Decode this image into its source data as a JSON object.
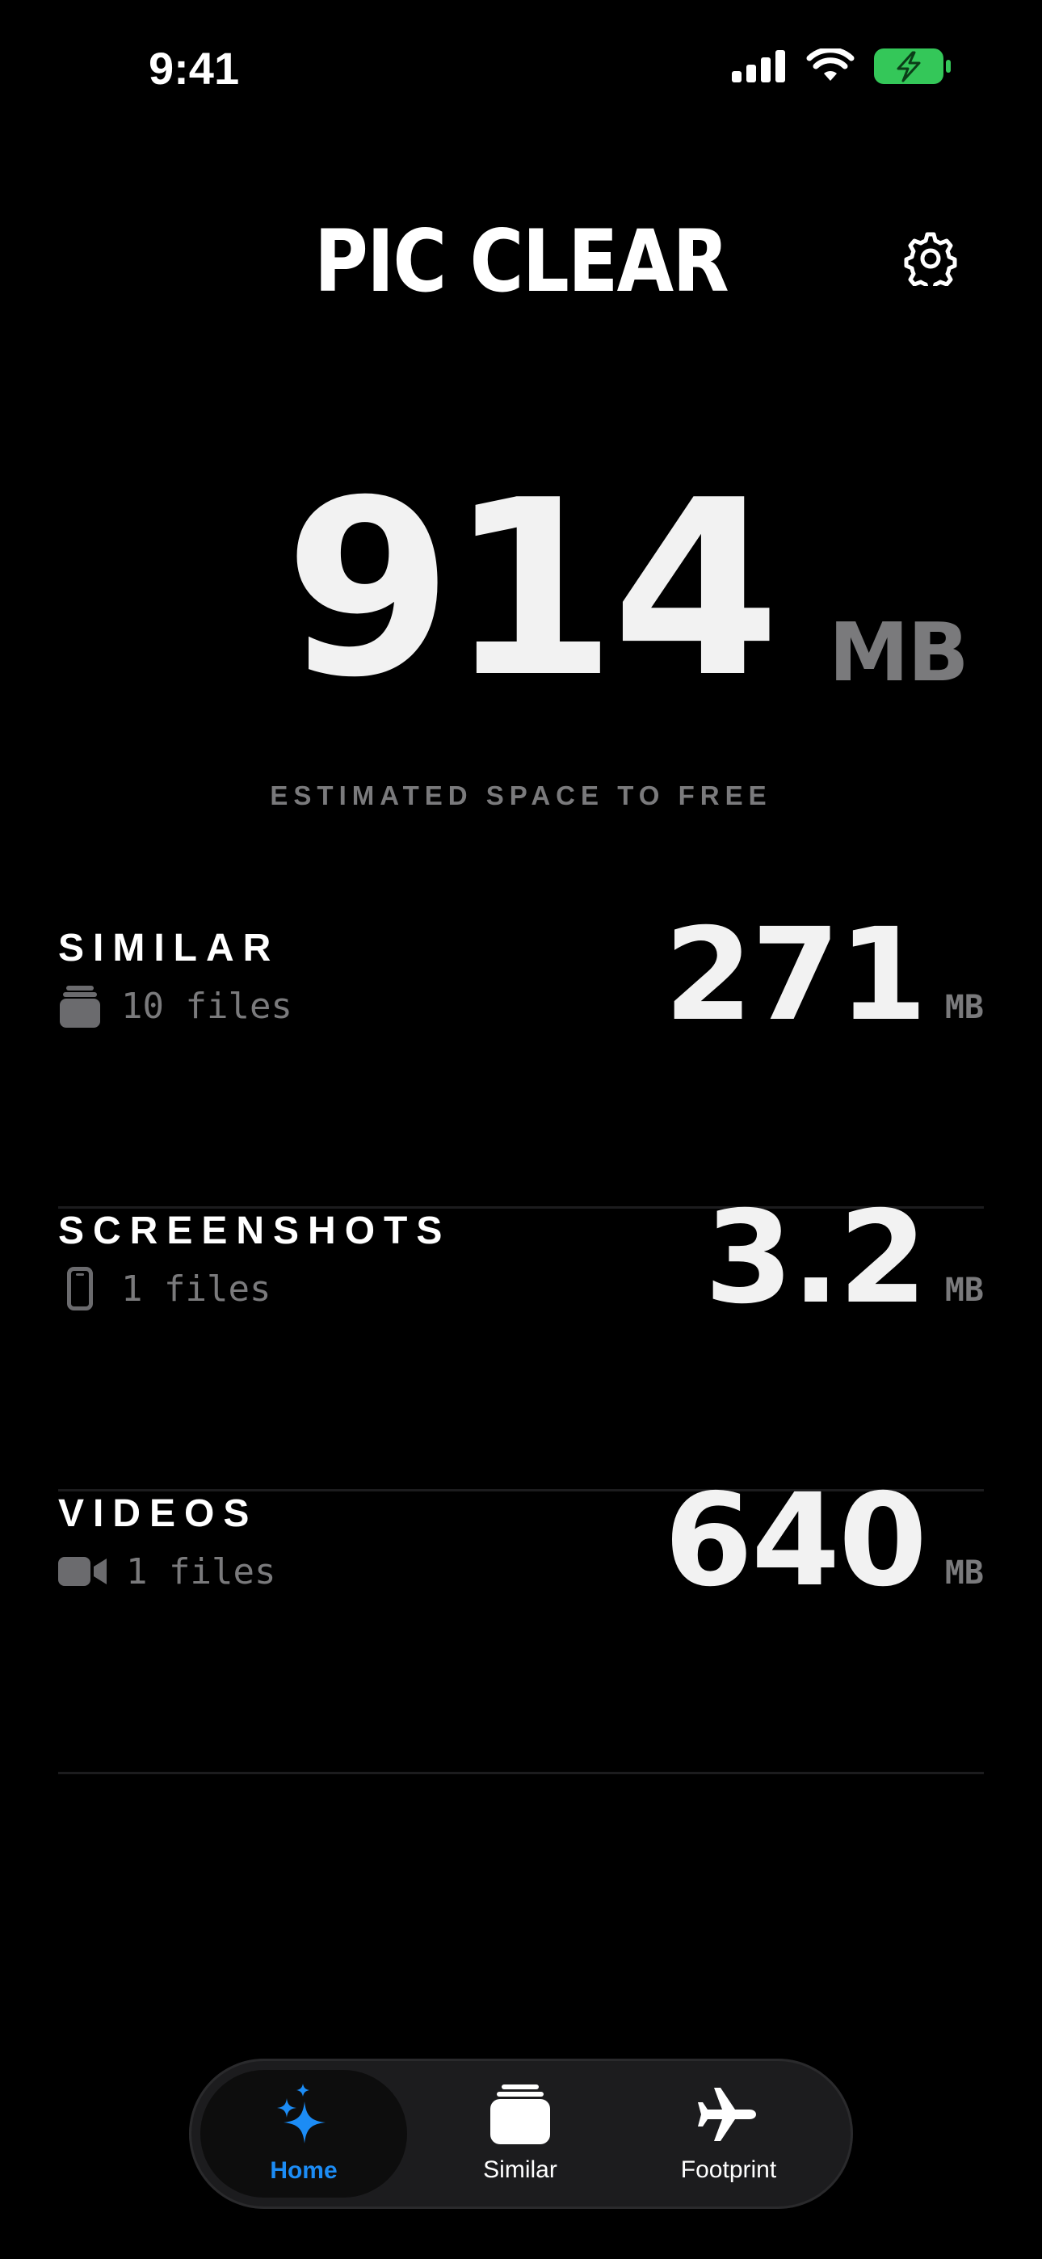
{
  "status_bar": {
    "time": "9:41"
  },
  "header": {
    "title": "PIC CLEAR",
    "settings_icon": "gear-icon"
  },
  "summary": {
    "value": "914",
    "unit": "MB",
    "caption": "ESTIMATED SPACE TO FREE"
  },
  "categories": [
    {
      "title": "SIMILAR",
      "count_label": "10 files",
      "value": "271",
      "unit": "MB",
      "icon": "photo-stack-icon"
    },
    {
      "title": "SCREENSHOTS",
      "count_label": "1 files",
      "value": "3.2",
      "unit": "MB",
      "icon": "phone-icon"
    },
    {
      "title": "VIDEOS",
      "count_label": "1 files",
      "value": "640",
      "unit": "MB",
      "icon": "video-camera-icon"
    }
  ],
  "tab_bar": {
    "tabs": [
      {
        "label": "Home",
        "icon": "sparkles-icon",
        "active": true
      },
      {
        "label": "Similar",
        "icon": "photo-stack-icon",
        "active": false
      },
      {
        "label": "Footprint",
        "icon": "airplane-icon",
        "active": false
      }
    ]
  },
  "colors": {
    "background": "#000000",
    "accent": "#1c8cf5",
    "muted": "#7a7a7c",
    "battery": "#34c759"
  }
}
